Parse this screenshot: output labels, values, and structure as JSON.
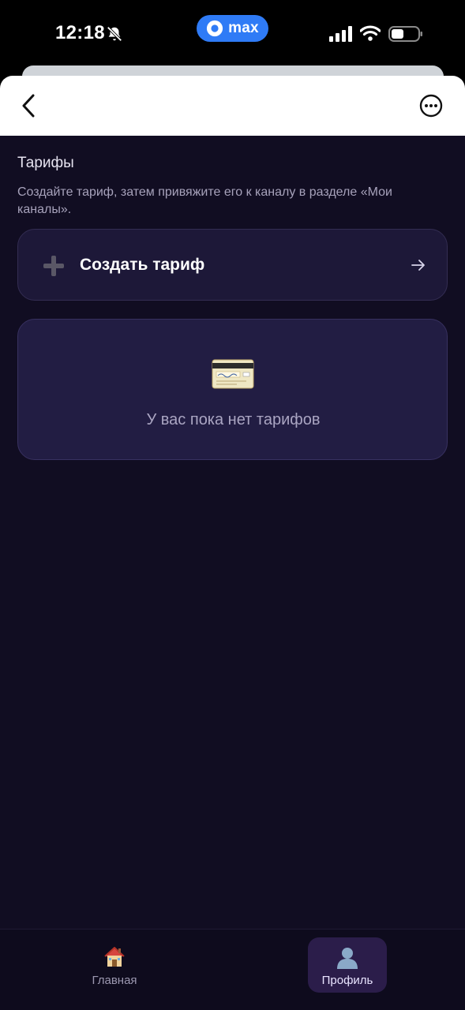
{
  "status_bar": {
    "time": "12:18",
    "app_pill_label": "max",
    "app_pill_color": "#2f7bf6"
  },
  "header": {
    "back_icon": "chevron-left-icon",
    "more_icon": "more-horizontal-circle-icon"
  },
  "page": {
    "section_title": "Тарифы",
    "section_description": "Создайте тариф, затем привяжите его к каналу в разделе «Мои каналы».",
    "create_button_label": "Создать тариф",
    "empty_state_text": "У вас пока нет тарифов"
  },
  "bottom_nav": {
    "items": [
      {
        "label": "Главная",
        "icon": "house-emoji-icon",
        "active": false
      },
      {
        "label": "Профиль",
        "icon": "user-silhouette-emoji-icon",
        "active": true
      }
    ]
  },
  "colors": {
    "background": "#110d22",
    "card": "#1d1838",
    "empty_card": "#221d43",
    "active_nav": "#2b1d4a"
  }
}
